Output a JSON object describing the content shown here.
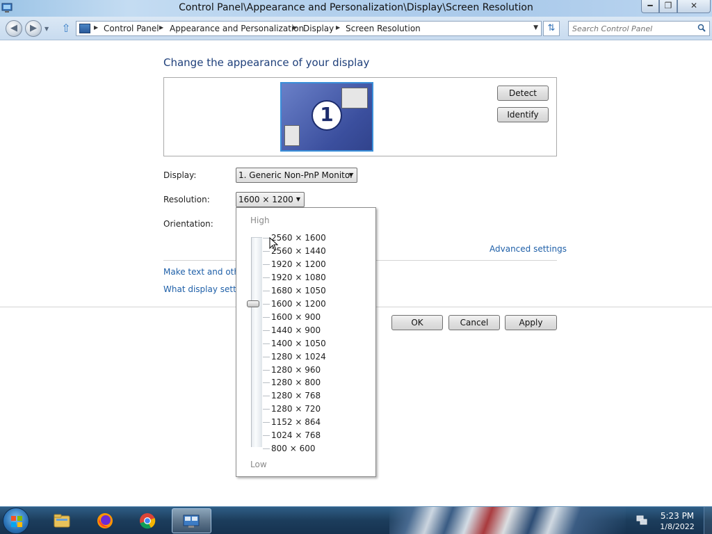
{
  "window": {
    "title": "Control Panel\\Appearance and Personalization\\Display\\Screen Resolution",
    "min_icon": "minimize-icon",
    "max_icon": "restore-icon",
    "close_icon": "close-icon"
  },
  "nav": {
    "back_glyph": "◀",
    "forward_glyph": "▶",
    "up_glyph": "⇧",
    "refresh_glyph": "⇅",
    "breadcrumbs": [
      "Control Panel",
      "Appearance and Personalization",
      "Display",
      "Screen Resolution"
    ],
    "search_placeholder": "Search Control Panel"
  },
  "main": {
    "heading": "Change the appearance of your display",
    "monitor_number": "1",
    "detect_label": "Detect",
    "identify_label": "Identify",
    "display_label": "Display:",
    "display_value": "1. Generic Non-PnP Monitor",
    "resolution_label": "Resolution:",
    "resolution_value": "1600 × 1200",
    "orientation_label": "Orientation:",
    "advanced_link": "Advanced settings",
    "link_text_size": "Make text and other",
    "link_display_settings": "What display setting",
    "ok_label": "OK",
    "cancel_label": "Cancel",
    "apply_label": "Apply"
  },
  "resolution_popup": {
    "high_label": "High",
    "low_label": "Low",
    "options": [
      "2560 × 1600",
      "2560 × 1440",
      "1920 × 1200",
      "1920 × 1080",
      "1680 × 1050",
      "1600 × 1200",
      "1600 × 900",
      "1440 × 900",
      "1400 × 1050",
      "1280 × 1024",
      "1280 × 960",
      "1280 × 800",
      "1280 × 768",
      "1280 × 720",
      "1152 × 864",
      "1024 × 768",
      "800 × 600"
    ],
    "selected_index": 5
  },
  "taskbar": {
    "apps": [
      "windows-explorer-icon",
      "firefox-icon",
      "chrome-icon",
      "display-settings-icon"
    ],
    "time": "5:23 PM",
    "date": "1/8/2022"
  },
  "colors": {
    "link": "#1e5fa8",
    "heading": "#1e3f7a",
    "monitor_border": "#3a8fd9"
  }
}
